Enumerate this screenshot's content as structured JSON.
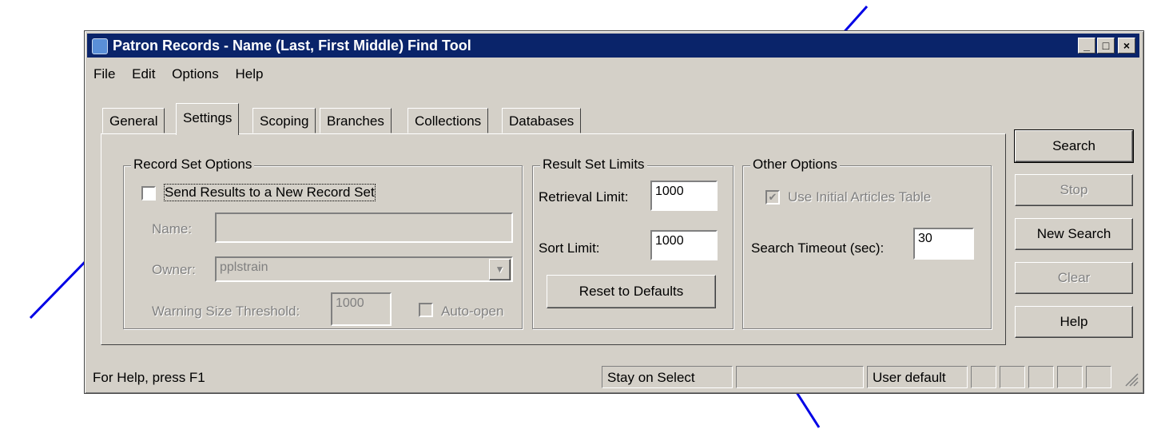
{
  "window": {
    "title": "Patron Records - Name (Last, First Middle) Find Tool",
    "controls": [
      "_",
      "□",
      "×"
    ]
  },
  "menu": [
    "File",
    "Edit",
    "Options",
    "Help"
  ],
  "tabs": [
    "General",
    "Settings",
    "Scoping",
    "Branches",
    "Collections",
    "Databases"
  ],
  "active_tab": "Settings",
  "record_set_options": {
    "group_label": "Record Set Options",
    "send_results_label": "Send Results to a New Record Set",
    "send_results_checked": false,
    "name_label": "Name:",
    "name_value": "",
    "owner_label": "Owner:",
    "owner_value": "pplstrain",
    "warning_label": "Warning Size Threshold:",
    "warning_value": "1000",
    "auto_open_label": "Auto-open",
    "auto_open_checked": false
  },
  "result_set_limits": {
    "group_label": "Result Set Limits",
    "retrieval_label": "Retrieval Limit:",
    "retrieval_value": "1000",
    "sort_label": "Sort Limit:",
    "sort_value": "1000",
    "reset_label": "Reset to Defaults"
  },
  "other_options": {
    "group_label": "Other Options",
    "initial_articles_label": "Use Initial Articles Table",
    "initial_articles_checked": true,
    "timeout_label": "Search Timeout (sec):",
    "timeout_value": "30"
  },
  "buttons": {
    "search": "Search",
    "stop": "Stop",
    "new_search": "New Search",
    "clear": "Clear",
    "help": "Help"
  },
  "status_bar": {
    "help_text": "For Help, press F1",
    "select_mode": "Stay on Select",
    "empty_pane": "",
    "user_setting": "User default"
  },
  "annotation_color": "#0000e6"
}
